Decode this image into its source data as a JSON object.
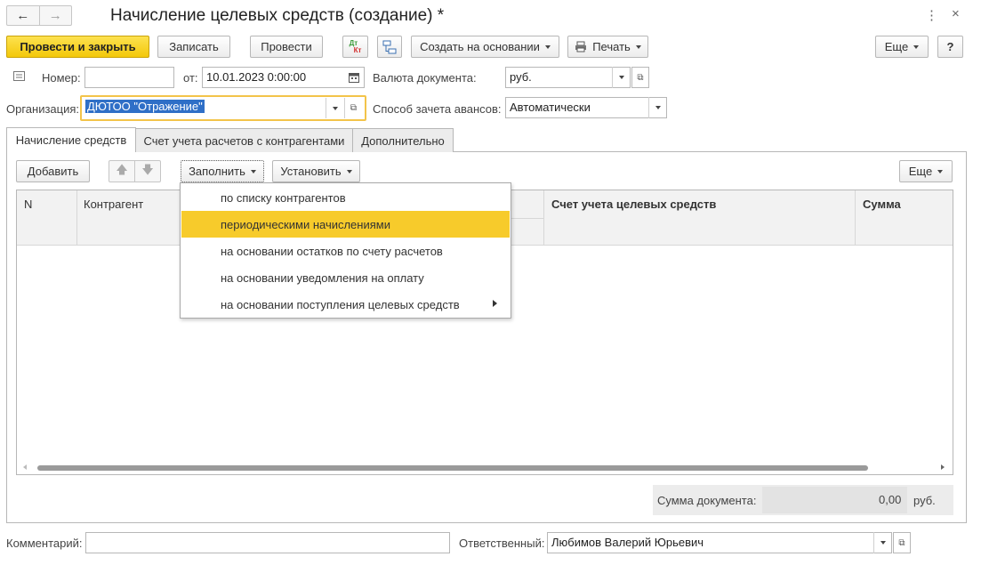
{
  "window": {
    "title": "Начисление целевых средств (создание) *"
  },
  "toolbar": {
    "post_close": "Провести и закрыть",
    "save": "Записать",
    "post": "Провести",
    "dt_kt_top": "Дт",
    "dt_kt_bottom": "Кт",
    "create_based": "Создать на основании",
    "print": "Печать",
    "more": "Еще",
    "help": "?"
  },
  "form": {
    "number_label": "Номер:",
    "number_value": "",
    "date_label": "от:",
    "date_value": "10.01.2023  0:00:00",
    "currency_label": "Валюта документа:",
    "currency_value": "руб.",
    "org_label": "Организация:",
    "org_value": "ДЮТОО \"Отражение\"",
    "advance_label": "Способ зачета авансов:",
    "advance_value": "Автоматически"
  },
  "tabs": [
    "Начисление средств",
    "Счет учета расчетов с контрагентами",
    "Дополнительно"
  ],
  "table_toolbar": {
    "add": "Добавить",
    "fill": "Заполнить",
    "set": "Установить",
    "more": "Еще"
  },
  "table": {
    "columns": [
      "N",
      "Контрагент",
      "Счет учета целевых средств",
      "Сумма"
    ]
  },
  "fill_menu": {
    "items": [
      "по списку контрагентов",
      "периодическими начислениями",
      "на основании остатков по счету расчетов",
      "на основании уведомления на оплату",
      "на основании поступления целевых средств"
    ],
    "highlighted_index": 1
  },
  "totals": {
    "label": "Сумма документа:",
    "value": "0,00",
    "currency": "руб."
  },
  "footer": {
    "comment_label": "Комментарий:",
    "comment_value": "",
    "responsible_label": "Ответственный:",
    "responsible_value": "Любимов Валерий Юрьевич"
  }
}
